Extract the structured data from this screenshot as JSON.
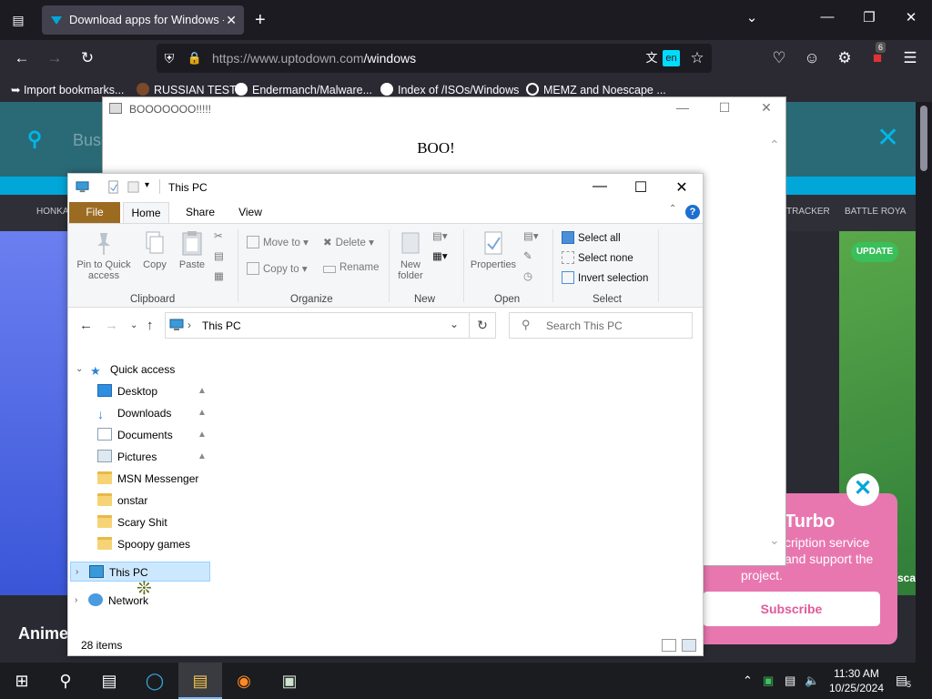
{
  "browser": {
    "tab_title": "Download apps for Windows - |",
    "url_host": "https://www.uptodown.com",
    "url_path": "/windows",
    "translate_badge": "en",
    "extension_badge": "6",
    "bookmarks": [
      "Import bookmarks...",
      "RUSSIAN TEST",
      "Endermanch/Malware...",
      "Index of /ISOs/Windows",
      "MEMZ and Noescape ..."
    ]
  },
  "website": {
    "search_placeholder": "Busc",
    "nav_items": [
      "HONKA",
      "TRACKER",
      "BATTLE ROYA"
    ],
    "update_badge": "UPDATE",
    "anime_heading": "Anime",
    "promo": {
      "title": "Turbo",
      "line1": "cription service",
      "line2": "and support the",
      "line3": "project.",
      "subscribe": "Subscribe",
      "side_text": "scap"
    }
  },
  "boo_window": {
    "title": "BOOOOOOO!!!!!",
    "message": "BOO!"
  },
  "explorer": {
    "title": "This PC",
    "ribbon_tabs": {
      "file": "File",
      "home": "Home",
      "share": "Share",
      "view": "View"
    },
    "ribbon": {
      "pin": "Pin to Quick access",
      "copy": "Copy",
      "paste": "Paste",
      "move_to": "Move to",
      "copy_to": "Copy to",
      "delete": "Delete",
      "rename": "Rename",
      "new_folder": "New folder",
      "properties": "Properties",
      "select_all": "Select all",
      "select_none": "Select none",
      "invert_selection": "Invert selection",
      "groups": {
        "clipboard": "Clipboard",
        "organize": "Organize",
        "new": "New",
        "open": "Open",
        "select": "Select"
      }
    },
    "address": "This PC",
    "search_placeholder": "Search This PC",
    "nav_tree": {
      "quick_access": "Quick access",
      "items": [
        "Desktop",
        "Downloads",
        "Documents",
        "Pictures",
        "MSN Messenger",
        "onstar",
        "Scary Shit",
        "Spoopy games"
      ],
      "this_pc": "This PC",
      "network": "Network"
    },
    "status": "28 items"
  },
  "taskbar": {
    "time": "11:30 AM",
    "date": "10/25/2024",
    "notification_count": "5"
  },
  "colors": {
    "browser_bg": "#1c1b22",
    "file_tab": "#9c6b22",
    "selection": "#cce8ff",
    "site_accent": "#00a7d8",
    "promo_pink": "#e877b0"
  }
}
